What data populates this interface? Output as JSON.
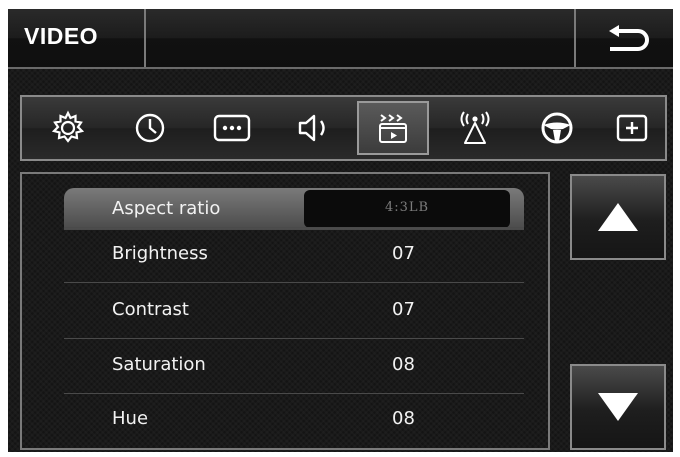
{
  "header": {
    "title": "VIDEO"
  },
  "icon_bar": [
    {
      "name": "settings-icon"
    },
    {
      "name": "clock-icon"
    },
    {
      "name": "more-icon"
    },
    {
      "name": "speaker-icon"
    },
    {
      "name": "video-icon",
      "active": true
    },
    {
      "name": "antenna-icon"
    },
    {
      "name": "steering-wheel-icon"
    },
    {
      "name": "add-icon"
    }
  ],
  "settings": {
    "aspect_ratio": {
      "label": "Aspect ratio",
      "value": "4:3LB"
    },
    "brightness": {
      "label": "Brightness",
      "value": "07"
    },
    "contrast": {
      "label": "Contrast",
      "value": "07"
    },
    "saturation": {
      "label": "Saturation",
      "value": "08"
    },
    "hue": {
      "label": "Hue",
      "value": "08"
    }
  },
  "colors": {
    "background": "#161616",
    "text": "#f2f2f2",
    "value_box_text": "#7c7c7c",
    "border": "#8a8a8a"
  }
}
